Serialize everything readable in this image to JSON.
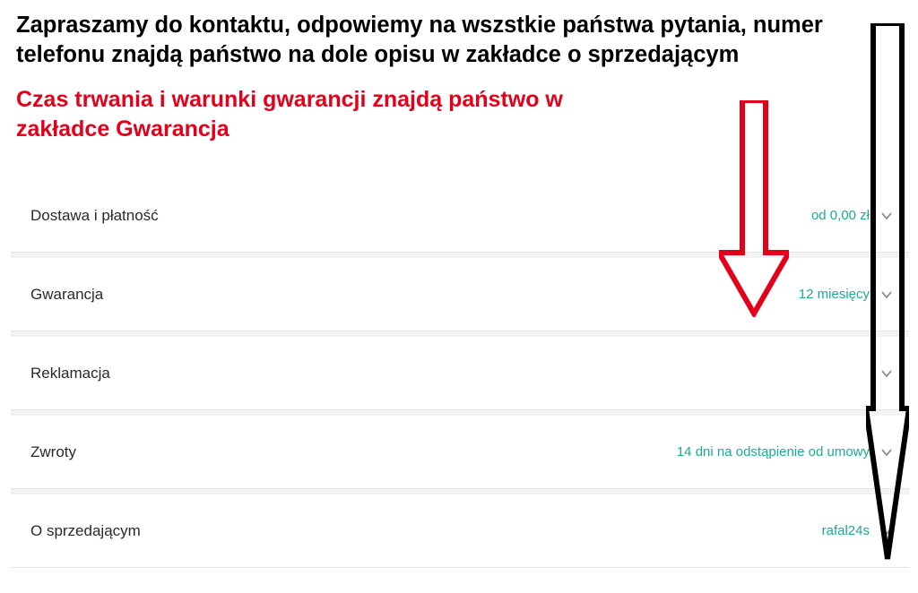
{
  "heading_black": "Zapraszamy do kontaktu, odpowiemy na wszstkie państwa pytania, numer telefonu znajdą państwo na dole opisu w zakładce o sprzedającym",
  "heading_red": "Czas trwania i warunki gwarancji znajdą państwo w zakładce Gwarancja",
  "accordion": {
    "delivery": {
      "label": "Dostawa i płatność",
      "value": "od 0,00 zł"
    },
    "warranty": {
      "label": "Gwarancja",
      "value": "12 miesięcy"
    },
    "complaint": {
      "label": "Reklamacja",
      "value": ""
    },
    "returns": {
      "label": "Zwroty",
      "value": "14 dni na odstąpienie od umowy"
    },
    "seller": {
      "label": "O sprzedającym",
      "value": "rafal24s"
    }
  }
}
